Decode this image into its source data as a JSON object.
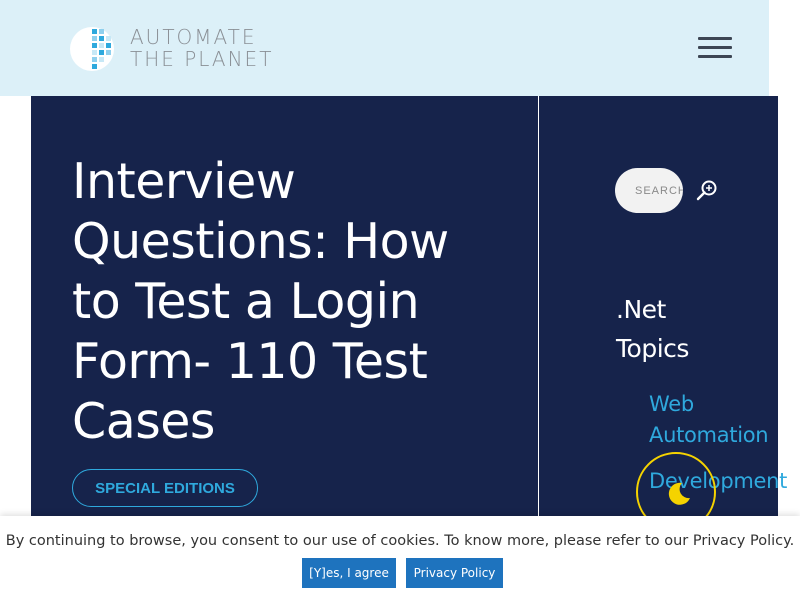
{
  "header": {
    "logo_line1": "AUTOMATE",
    "logo_line2": "THE PLANET",
    "menu_icon": "hamburger-menu-icon"
  },
  "article": {
    "title": "Interview Questions: How to Test a Login Form- 110 Test Cases",
    "category": "SPECIAL EDITIONS"
  },
  "sidebar": {
    "search_placeholder": "SEARCH",
    "search_icon": "magnifier-plus-icon",
    "topics_line1": ".Net",
    "topics_line2": "Topics",
    "links": [
      "Web",
      "Automation",
      "Development"
    ]
  },
  "cookie": {
    "text": "By continuing to browse, you consent to our use of cookies. To know more, please refer to our Privacy Policy.",
    "agree_label": "[Y]es, I agree",
    "policy_label": "Privacy Policy"
  },
  "colors": {
    "header_bg": "#dcf0f8",
    "hero_bg": "#16234b",
    "accent": "#2fa9dd",
    "button": "#1e73be",
    "moon": "#f5d300"
  },
  "dark_mode_icon": "moon-icon"
}
